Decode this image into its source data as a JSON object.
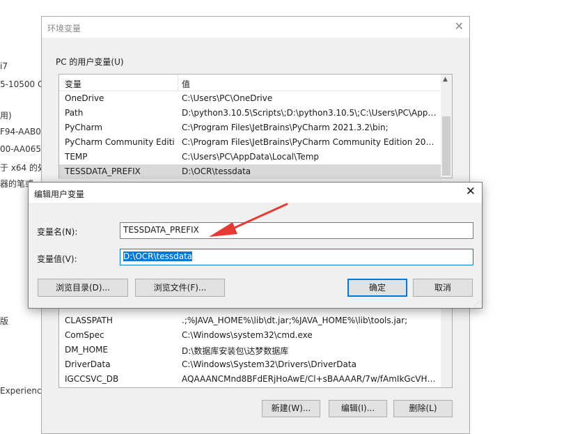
{
  "background": {
    "fragments": [
      "i7",
      "5-10500 C",
      "用)",
      "F94-AAB0",
      "00-AA065",
      "于 x64 的处",
      "器的笔或",
      "版",
      "Experienc"
    ]
  },
  "env_window": {
    "title": "环境变量",
    "user_group_label": "PC 的用户变量(U)",
    "columns": {
      "variable": "变量",
      "value": "值"
    },
    "rows_top": [
      {
        "name": "OneDrive",
        "value": "C:\\Users\\PC\\OneDrive"
      },
      {
        "name": "Path",
        "value": "D:\\python3.10.5\\Scripts\\;D:\\python3.10.5\\;C:\\Users\\PC\\AppDa..."
      },
      {
        "name": "PyCharm",
        "value": "C:\\Program Files\\JetBrains\\PyCharm 2021.3.2\\bin;"
      },
      {
        "name": "PyCharm Community Editi...",
        "value": "C:\\Program Files\\JetBrains\\PyCharm Community Edition 2021...."
      },
      {
        "name": "TEMP",
        "value": "C:\\Users\\PC\\AppData\\Local\\Temp"
      },
      {
        "name": "TESSDATA_PREFIX",
        "value": "D:\\OCR\\tessdata"
      }
    ],
    "rows_bottom": [
      {
        "name": "CLASSPATH",
        "value": ".;%JAVA_HOME%\\lib\\dt.jar;%JAVA_HOME%\\lib\\tools.jar;"
      },
      {
        "name": "ComSpec",
        "value": "C:\\Windows\\system32\\cmd.exe"
      },
      {
        "name": "DM_HOME",
        "value": "D:\\数据库安装包\\达梦数据库"
      },
      {
        "name": "DriverData",
        "value": "C:\\Windows\\System32\\Drivers\\DriverData"
      },
      {
        "name": "IGCCSVC_DB",
        "value": "AQAAANCMnd8BFdERjHoAwE/Cl+sBAAAAR/7w/fAmIkGcVHff..."
      }
    ],
    "buttons": {
      "new": "新建(W)...",
      "edit": "编辑(I)...",
      "delete": "删除(L)"
    }
  },
  "edit_dialog": {
    "title": "编辑用户变量",
    "name_label": "变量名(N):",
    "name_value": "TESSDATA_PREFIX",
    "value_label": "变量值(V):",
    "value_value": "D:\\OCR\\tessdata",
    "browse_dir": "浏览目录(D)...",
    "browse_file": "浏览文件(F)...",
    "ok": "确定",
    "cancel": "取消"
  },
  "colors": {
    "accent": "#0078d7",
    "arrow": "#e53935",
    "selected_row": "#d9d9d9"
  }
}
